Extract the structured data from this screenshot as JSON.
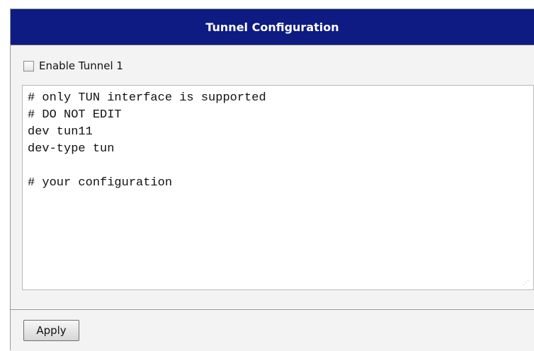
{
  "header": {
    "title": "Tunnel Configuration"
  },
  "enable_tunnel": {
    "label": "Enable Tunnel 1",
    "checked": false
  },
  "config_textarea": {
    "value": "# only TUN interface is supported\n# DO NOT EDIT\ndev tun11\ndev-type tun\n\n# your configuration"
  },
  "footer": {
    "apply_label": "Apply"
  }
}
